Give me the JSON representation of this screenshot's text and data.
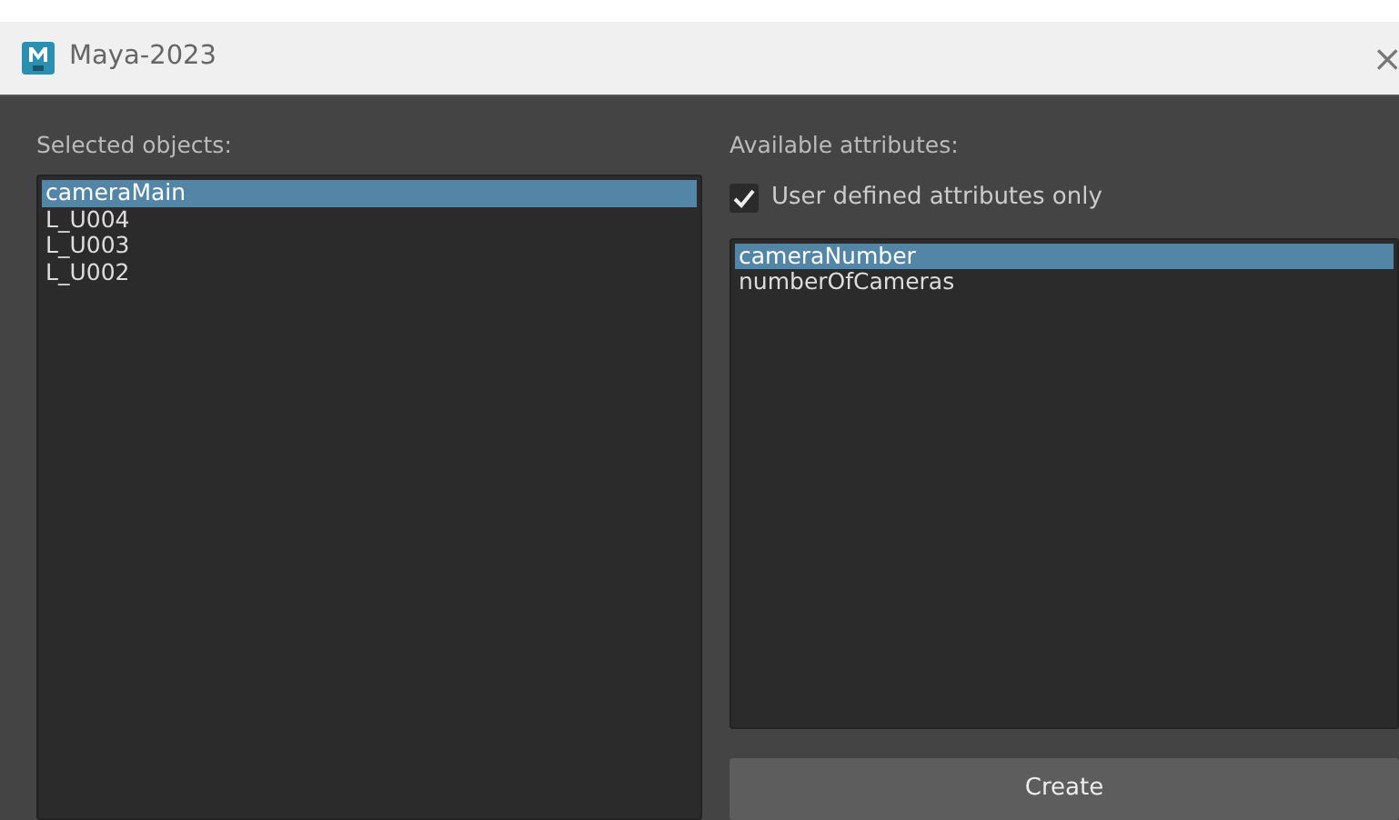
{
  "window": {
    "title": "Maya-2023",
    "close": "×"
  },
  "selected_objects": {
    "label": "Selected objects:",
    "items": [
      {
        "text": "cameraMain",
        "selected": true
      },
      {
        "text": "L_U004",
        "selected": false
      },
      {
        "text": "L_U003",
        "selected": false
      },
      {
        "text": "L_U002",
        "selected": false
      }
    ]
  },
  "available_attributes": {
    "label": "Available attributes:",
    "user_defined_only": {
      "label": "User defined attributes only",
      "checked": true
    },
    "items": [
      {
        "text": "cameraNumber",
        "selected": true
      },
      {
        "text": "numberOfCameras",
        "selected": false
      }
    ]
  },
  "buttons": [
    "Create"
  ]
}
